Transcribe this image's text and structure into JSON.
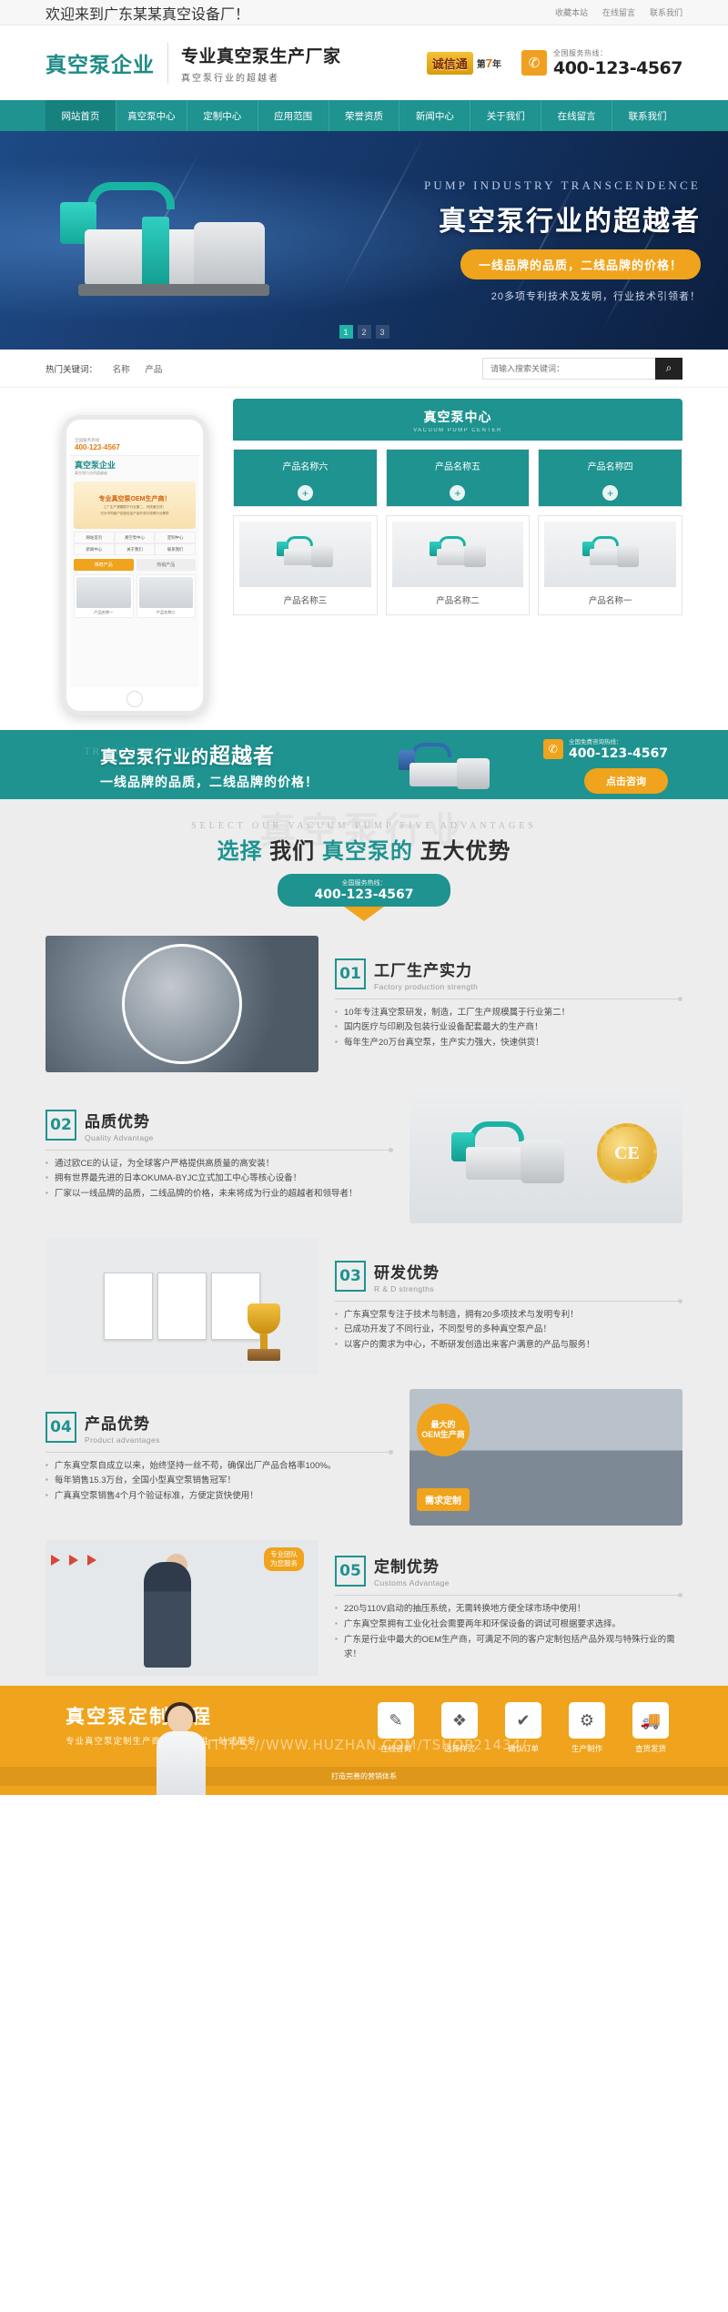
{
  "topbar": {
    "welcome": "欢迎来到广东某某真空设备厂！",
    "links": [
      {
        "label": "收藏本站",
        "name": "favorite"
      },
      {
        "label": "在线留言",
        "name": "message"
      },
      {
        "label": "联系我们",
        "name": "contact"
      }
    ]
  },
  "header": {
    "logo": "真空泵企业",
    "slogan_main": "专业真空泵生产厂家",
    "slogan_sub": "真空泵行业的超越者",
    "badge_seal": "诚信通",
    "badge_year_prefix": "第",
    "badge_year_num": "7",
    "badge_year_suffix": "年",
    "tel_label": "全国服务热线：",
    "tel_number": "400-123-4567",
    "phone_icon": "phone-icon"
  },
  "nav": {
    "items": [
      {
        "label": "网站首页",
        "name": "home",
        "active": true
      },
      {
        "label": "真空泵中心",
        "name": "pump-center",
        "active": false
      },
      {
        "label": "定制中心",
        "name": "custom-center",
        "active": false
      },
      {
        "label": "应用范围",
        "name": "applications",
        "active": false
      },
      {
        "label": "荣誉资质",
        "name": "honors",
        "active": false
      },
      {
        "label": "新闻中心",
        "name": "news",
        "active": false
      },
      {
        "label": "关于我们",
        "name": "about",
        "active": false
      },
      {
        "label": "在线留言",
        "name": "message",
        "active": false
      },
      {
        "label": "联系我们",
        "name": "contact",
        "active": false
      }
    ]
  },
  "hero": {
    "english": "PUMP INDUSTRY TRANSCENDENCE",
    "heading": "真空泵行业的超越者",
    "pill": "一线品牌的品质，二线品牌的价格！",
    "sub": "20多项专利技术及发明，行业技术引领者！",
    "dots": [
      "1",
      "2",
      "3"
    ],
    "active_dot": 0
  },
  "search": {
    "keywords_label": "热门关键词：",
    "keywords": [
      "名称",
      "产品"
    ],
    "placeholder": "请输入搜索关键词：",
    "value": "",
    "button_icon": "search-icon"
  },
  "phone_preview": {
    "top_note": "全国服务热线：",
    "top_tel": "400-123-4567",
    "logo": "真空泵企业",
    "logo_sub": "真空泵行业的超越者",
    "banner_title": "专业真空泵OEM生产商！",
    "banner_sub_1": "工厂生产规模属于行业第二，可快速交货！",
    "banner_sub_2": "可为不同客户定制包括产品外观与特殊行业需求",
    "nav": [
      "网站首页",
      "真空泵中心",
      "定制中心",
      "新闻中心",
      "关于我们",
      "联系我们"
    ],
    "tabs": [
      "推荐产品",
      "热销产品"
    ],
    "cards": [
      "产品名称一",
      "产品名称二"
    ]
  },
  "products": {
    "category_title": "真空泵中心",
    "category_en": "VACUUM PUMP CENTER",
    "items": [
      {
        "name": "产品名称六",
        "style": "white"
      },
      {
        "name": "产品名称五",
        "style": "white"
      },
      {
        "name": "产品名称四",
        "style": "white"
      },
      {
        "name": "产品名称三",
        "style": "white"
      },
      {
        "name": "产品名称二",
        "style": "white"
      },
      {
        "name": "产品名称一",
        "style": "white"
      }
    ],
    "teal_items": [
      {
        "name": "产品名称六"
      },
      {
        "name": "产品名称五"
      },
      {
        "name": "产品名称四"
      }
    ],
    "plus_icon": "plus-icon"
  },
  "cta": {
    "english": "TRANSCENDENCE",
    "heading_pre": "真空泵行业的",
    "heading_em": "超越者",
    "sub": "一线品牌的品质，二线品牌的价格！",
    "tel_label": "全国免费咨询热线：",
    "tel_number": "400-123-4567",
    "button": "点击咨询",
    "phone_icon": "phone-icon"
  },
  "advantages": {
    "watermark": "真空泵行业",
    "english": "SELECT OUR VACUUM PUMP FIVE ADVANTAGES",
    "title_pre": "选择",
    "title_em1": "我们",
    "title_mid": "真空泵的",
    "title_em2": "五大优势",
    "tel_label": "全国服务热线：",
    "tel_number": "400-123-4567",
    "items": [
      {
        "num": "01",
        "title": "工厂生产实力",
        "title_en": "Factory production strength",
        "image": "workers-photo",
        "bullets": [
          "10年专注真空泵研发，制造，工厂生产规模属于行业第二！",
          "国内医疗与印刷及包装行业设备配套最大的生产商！",
          "每年生产20万台真空泵，生产实力强大，快速供货！"
        ]
      },
      {
        "num": "02",
        "title": "品质优势",
        "title_en": "Quality Advantage",
        "image": "pump-ce-photo",
        "bullets": [
          "通过欧CE的认证，为全球客户严格提供高质量的高安装！",
          "拥有世界最先进的日本OKUMA-BYJC立式加工中心等核心设备！",
          "厂家以一线品牌的品质，二线品牌的价格，未来将成为行业的超越者和领导者！"
        ]
      },
      {
        "num": "03",
        "title": "研发优势",
        "title_en": "R & D strengths",
        "image": "certificates-trophy-photo",
        "bullets": [
          "广东真空泵专注于技术与制造，拥有20多项技术与发明专利！",
          "已成功开发了不同行业，不同型号的多种真空泵产品！",
          "以客户的需求为中心，不断研发创造出来客户满意的产品与服务！"
        ]
      },
      {
        "num": "04",
        "title": "产品优势",
        "title_en": "Product advantages",
        "image": "oem-factory-photo",
        "bullets": [
          "广东真空泵自成立以来，始终坚持一丝不苟，确保出厂产品合格率100%。",
          "每年销售15.3万台，全国小型真空泵销售冠军！",
          "广真真空泵销售4个月个验证标准，方便定货快使用！"
        ]
      },
      {
        "num": "05",
        "title": "定制优势",
        "title_en": "Customs Advantage",
        "image": "consultant-map-photo",
        "bullets": [
          "220与110V启动的抽压系统，无需转换地方便全球市场中使用！",
          "广东真空泵拥有工业化社会需要两年和环保设备的调试可根据要求选择。",
          "广东是行业中最大的OEM生产商，可满足不同的客户定制包括产品外观与特殊行业的需求！"
        ]
      }
    ],
    "oem_badge_1": "最大的",
    "oem_badge_2": "OEM生产商",
    "need_badge": "需求定制",
    "orange_tag_1": "专业团队",
    "orange_tag_2": "为您服务"
  },
  "footer": {
    "heading": "真空泵定制流程",
    "sub": "专业真空泵定制生产商，为您提供一站式服务",
    "steps": [
      {
        "label": "在线咨询",
        "icon": "pencil-icon",
        "glyph": "✎"
      },
      {
        "label": "选择样式",
        "icon": "grid-icon",
        "glyph": "❖"
      },
      {
        "label": "确认订单",
        "icon": "check-icon",
        "glyph": "✔"
      },
      {
        "label": "生产制作",
        "icon": "factory-icon",
        "glyph": "⚙"
      },
      {
        "label": "查货发货",
        "icon": "truck-icon",
        "glyph": "🚚"
      }
    ],
    "watermark": "HTTPS://WWW.HUZHAN.COM/TSHOP21434/",
    "bottom": "打造完善的营销体系"
  }
}
